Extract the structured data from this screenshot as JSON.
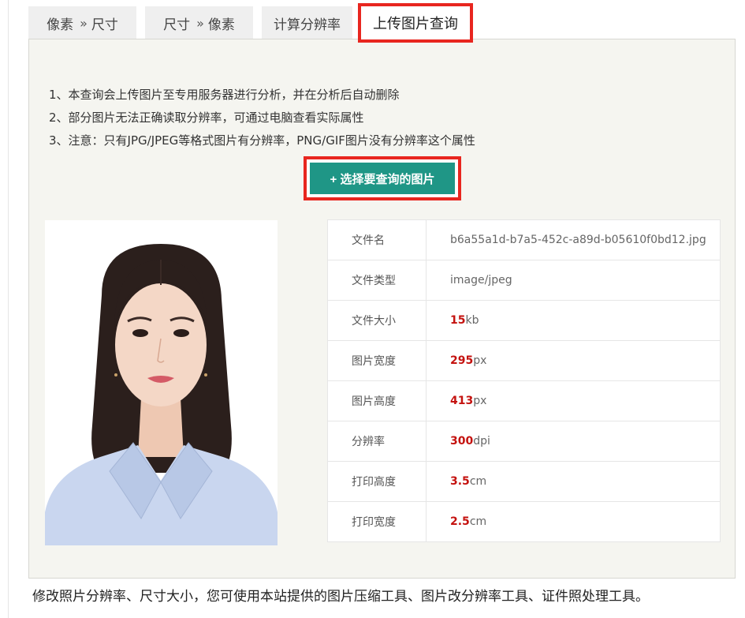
{
  "tabs": [
    {
      "label_a": "像素",
      "sep": "»",
      "label_b": "尺寸"
    },
    {
      "label_a": "尺寸",
      "sep": "»",
      "label_b": "像素"
    },
    {
      "label": "计算分辨率"
    },
    {
      "label": "上传图片查询",
      "active": true
    }
  ],
  "notes": [
    "1、本查询会上传图片至专用服务器进行分析，并在分析后自动删除",
    "2、部分图片无法正确读取分辨率，可通过电脑查看实际属性",
    "3、注意：只有JPG/JPEG等格式图片有分辨率，PNG/GIF图片没有分辨率这个属性"
  ],
  "upload_button": "+ 选择要查询的图片",
  "info": [
    {
      "key": "文件名",
      "value": "b6a55a1d-b7a5-452c-a89d-b05610f0bd12.jpg"
    },
    {
      "key": "文件类型",
      "value": "image/jpeg"
    },
    {
      "key": "文件大小",
      "num": "15",
      "unit": "kb"
    },
    {
      "key": "图片宽度",
      "num": "295",
      "unit": "px"
    },
    {
      "key": "图片高度",
      "num": "413",
      "unit": "px"
    },
    {
      "key": "分辨率",
      "num": "300",
      "unit": "dpi"
    },
    {
      "key": "打印高度",
      "num": "3.5",
      "unit": "cm"
    },
    {
      "key": "打印宽度",
      "num": "2.5",
      "unit": "cm"
    }
  ],
  "footer": "修改照片分辨率、尺寸大小，您可使用本站提供的图片压缩工具、图片改分辨率工具、证件照处理工具。",
  "colors": {
    "accent": "#1f9686",
    "highlight": "#e8261f",
    "value_red": "#c4120f"
  }
}
